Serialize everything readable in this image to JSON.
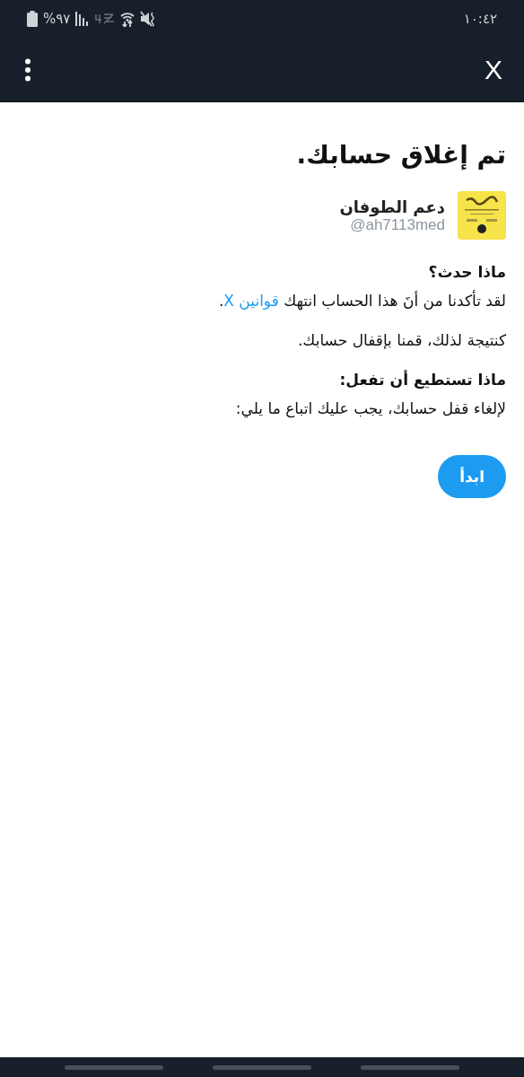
{
  "status_bar": {
    "time": "١٠:٤٢",
    "battery": "%٩٧"
  },
  "app_bar": {
    "close": "X"
  },
  "title": "تم إغلاق حسابك.",
  "account": {
    "name": "دعم الطوفان",
    "handle": "@ah7113med"
  },
  "sections": [
    {
      "heading": "ماذا حدث؟",
      "paragraphs": [
        {
          "text": "لقد تأكدنا من أنَ هذا الحساب انتهك",
          "link": "قوانين X",
          "end": "."
        },
        {
          "text": "كنتيجة لذلك، قمنا بإقفال حسابك."
        }
      ]
    },
    {
      "heading": "ماذا تستطيع أن تفعل:",
      "paragraphs": [
        {
          "text": "لإلغاء قفل حسابك، يجب عليك اتباع ما يلي:"
        }
      ]
    }
  ],
  "start_button": "ابدأ"
}
